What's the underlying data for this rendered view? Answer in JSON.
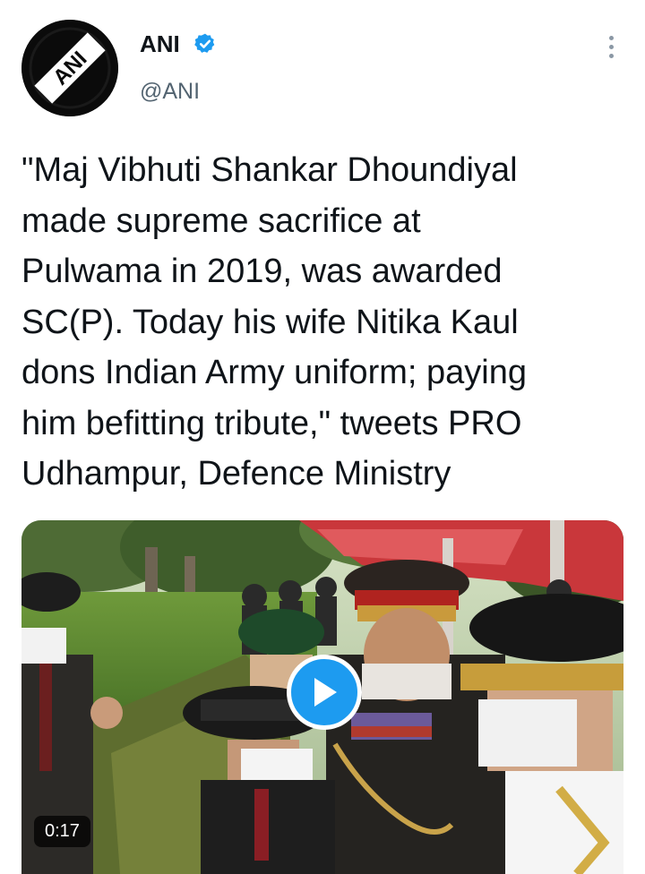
{
  "tweet": {
    "author": {
      "display_name": "ANI",
      "handle": "@ANI",
      "verified": true,
      "avatar_logo_text": "ANI"
    },
    "text": "\"Maj Vibhuti Shankar Dhoundiyal\nmade supreme sacrifice at\nPulwama in 2019, was awarded\nSC(P). Today his wife Nitika Kaul\ndons Indian Army uniform; paying\nhim befitting tribute,\" tweets PRO\nUdhampur, Defence Ministry",
    "media": {
      "type": "video",
      "duration": "0:17",
      "play_icon": "play-icon"
    }
  },
  "colors": {
    "accent": "#1d9bf0",
    "text": "#0f1419",
    "secondary_text": "#536471"
  }
}
